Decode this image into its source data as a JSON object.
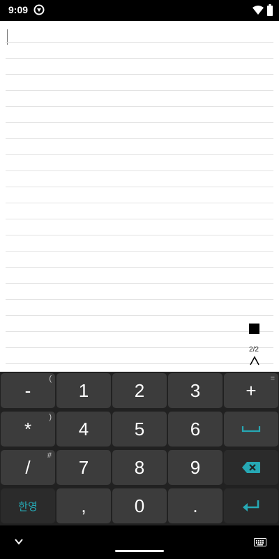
{
  "status_bar": {
    "time": "9:09",
    "icons": [
      "app-notification-icon",
      "wifi-icon",
      "battery-icon"
    ]
  },
  "editor": {
    "text": "",
    "page_indicator": "2/2",
    "icons": [
      "stop-icon",
      "chevron-up-icon"
    ]
  },
  "keyboard": {
    "rows": [
      [
        {
          "label": "-",
          "hint": "("
        },
        {
          "label": "1",
          "hint": ""
        },
        {
          "label": "2",
          "hint": ""
        },
        {
          "label": "3",
          "hint": ""
        },
        {
          "label": "+",
          "hint": "="
        }
      ],
      [
        {
          "label": "*",
          "hint": ")"
        },
        {
          "label": "4",
          "hint": ""
        },
        {
          "label": "5",
          "hint": ""
        },
        {
          "label": "6",
          "hint": ""
        },
        {
          "label": "",
          "icon": "space-icon"
        }
      ],
      [
        {
          "label": "/",
          "hint": "#"
        },
        {
          "label": "7",
          "hint": ""
        },
        {
          "label": "8",
          "hint": ""
        },
        {
          "label": "9",
          "hint": ""
        },
        {
          "label": "",
          "icon": "backspace-icon"
        }
      ],
      [
        {
          "label": "한영",
          "hint": ""
        },
        {
          "label": ",",
          "hint": ""
        },
        {
          "label": "0",
          "hint": ""
        },
        {
          "label": ".",
          "hint": ""
        },
        {
          "label": "",
          "icon": "enter-icon"
        }
      ]
    ],
    "accent_color": "#26a8b4"
  },
  "nav_bar": {
    "icons": [
      "chevron-down-icon",
      "keyboard-switch-icon"
    ]
  }
}
